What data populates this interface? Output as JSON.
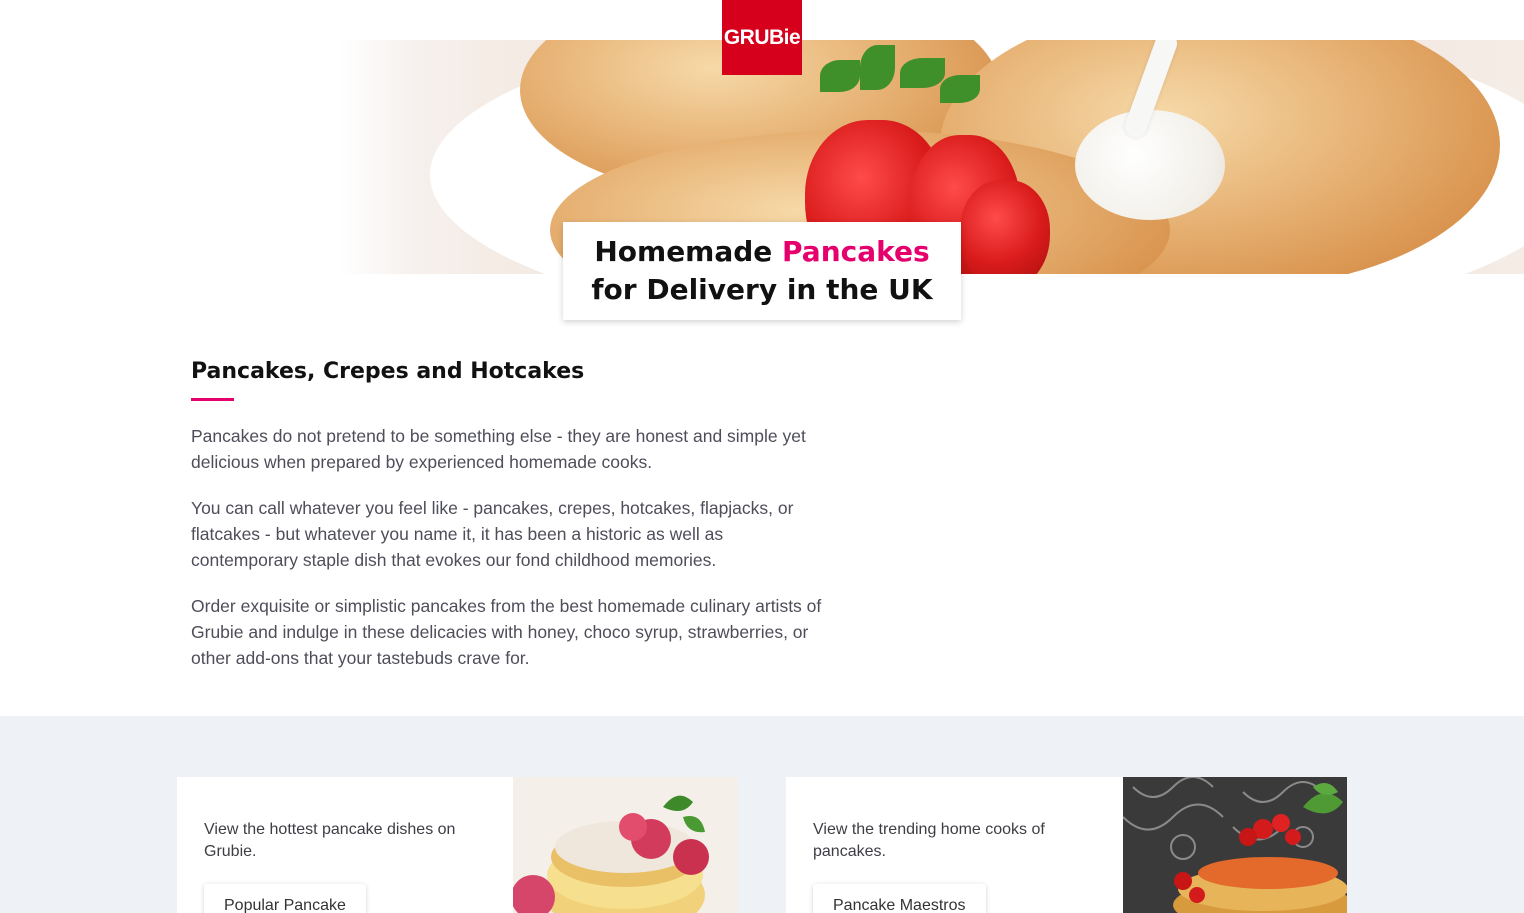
{
  "brand": {
    "logo_text": "GRUBie"
  },
  "hero": {
    "title_part1": "Homemade ",
    "title_accent": "Pancakes",
    "title_line2": "for Delivery in the UK"
  },
  "section": {
    "heading": "Pancakes, Crepes and Hotcakes",
    "paragraphs": [
      "Pancakes do not pretend to be something else - they are honest and simple yet delicious when prepared by experienced homemade cooks.",
      "You can call whatever you feel like - pancakes, crepes, hotcakes, flapjacks, or flatcakes - but whatever you name it, it has been a historic as well as contemporary staple dish that evokes our fond childhood memories.",
      "Order exquisite or simplistic pancakes from the best homemade culinary artists of Grubie and indulge in these delicacies with honey, choco syrup, strawberries, or other add-ons that your tastebuds crave for."
    ]
  },
  "cards": [
    {
      "text": "View the hottest pancake dishes on Grubie.",
      "button": "Popular Pancake"
    },
    {
      "text": "View the trending home cooks of pancakes.",
      "button": "Pancake Maestros"
    }
  ],
  "colors": {
    "brand_red": "#d6001c",
    "accent_pink": "#e6006e",
    "section_bg": "#eef1f6"
  }
}
